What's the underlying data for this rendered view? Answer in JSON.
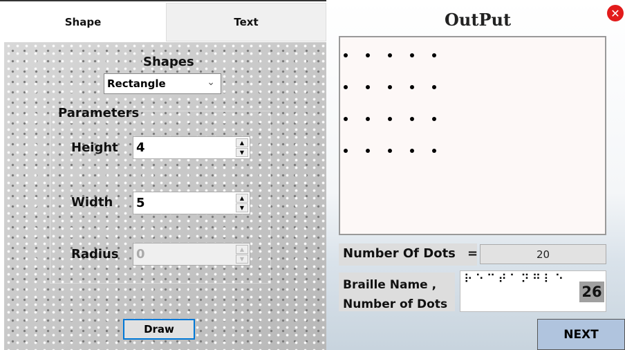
{
  "tabs": [
    {
      "label": "Shape",
      "active": true
    },
    {
      "label": "Text",
      "active": false
    }
  ],
  "shape_panel": {
    "shapes_label": "Shapes",
    "shape_select": "Rectangle",
    "parameters_label": "Parameters",
    "height_label": "Height",
    "height_value": "4",
    "width_label": "Width",
    "width_value": "5",
    "radius_label": "Radius",
    "radius_value": "0",
    "draw_label": "Draw"
  },
  "output": {
    "title": "OutPut",
    "grid": {
      "rows": 4,
      "cols": 5
    },
    "number_of_dots_label": "Number Of Dots",
    "equals": "=",
    "number_of_dots_value": "20",
    "braille_label_line1": "Braille Name ,",
    "braille_label_line2": "Number of Dots",
    "braille_text": "⠗⠑⠉⠞⠁⠝⠛⠇⠑",
    "braille_dot_count": "26",
    "next_label": "NEXT"
  },
  "colors": {
    "close": "#e21b1b",
    "next_button": "#b0c4de",
    "draw_border": "#0078d7"
  }
}
